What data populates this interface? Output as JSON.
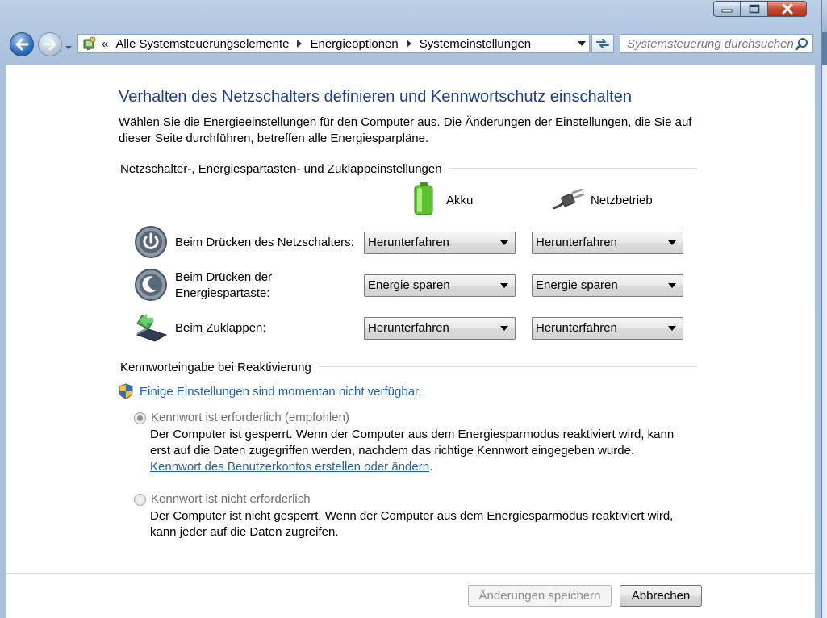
{
  "window": {
    "minimize_icon": "minimize-icon",
    "maximize_icon": "maximize-icon",
    "close_icon": "close-icon"
  },
  "nav": {
    "back_icon": "back-arrow-icon",
    "forward_icon": "forward-arrow-icon",
    "breadcrumb_overflow": "«",
    "breadcrumb": [
      "Alle Systemsteuerungselemente",
      "Energieoptionen",
      "Systemeinstellungen"
    ],
    "search_placeholder": "Systemsteuerung durchsuchen"
  },
  "page": {
    "title": "Verhalten des Netzschalters definieren und Kennwortschutz einschalten",
    "intro": "Wählen Sie die Energieeinstellungen für den Computer aus. Die Änderungen der Einstellungen, die Sie auf dieser Seite durchführen, betreffen alle Energiesparpläne."
  },
  "buttons_section": {
    "heading": "Netzschalter-, Energiespartasten- und Zuklappeinstellungen",
    "columns": {
      "battery": "Akku",
      "plugged_in": "Netzbetrieb"
    },
    "rows": [
      {
        "label": "Beim Drücken des Netzschalters:",
        "battery": "Herunterfahren",
        "plugged_in": "Herunterfahren"
      },
      {
        "label_line1": "Beim Drücken der",
        "label_line2": "Energiespartaste:",
        "battery": "Energie sparen",
        "plugged_in": "Energie sparen"
      },
      {
        "label": "Beim Zuklappen:",
        "battery": "Herunterfahren",
        "plugged_in": "Herunterfahren"
      }
    ]
  },
  "password_section": {
    "heading": "Kennworteingabe bei Reaktivierung",
    "notice": "Einige Einstellungen sind momentan nicht verfügbar.",
    "option_required": {
      "label": "Kennwort ist erforderlich (empfohlen)",
      "description": "Der Computer ist gesperrt. Wenn der Computer aus dem Energiesparmodus reaktiviert wird, kann erst auf die Daten zugegriffen werden, nachdem das richtige Kennwort eingegeben wurde.",
      "link": "Kennwort des Benutzerkontos erstellen oder ändern",
      "link_suffix": "."
    },
    "option_not_required": {
      "label": "Kennwort ist nicht erforderlich",
      "description": "Der Computer ist nicht gesperrt. Wenn der Computer aus dem Energiesparmodus reaktiviert wird, kann jeder auf die Daten zugreifen."
    },
    "selected": "required"
  },
  "footer": {
    "save_label": "Änderungen speichern",
    "cancel_label": "Abbrechen"
  },
  "colors": {
    "title": "#1e3d8a",
    "link": "#1c61b3",
    "close_button": "#c7492f"
  }
}
